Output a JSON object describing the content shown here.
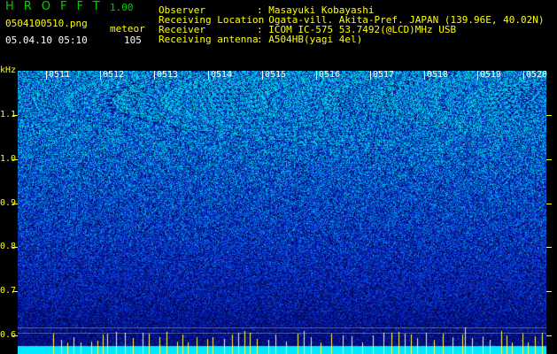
{
  "header": {
    "app_title": "HROFFT",
    "app_version": "1.00",
    "filename": "0504100510.png",
    "meteor_label": "meteor",
    "datetime": "05.04.10 05:10",
    "meteor_count": "105",
    "observer_key": "Observer",
    "observer_value": ": Masayuki Kobayashi",
    "location_key": "Receiving Location",
    "location_value": ": Ogata-vill. Akita-Pref. JAPAN (139.96E, 40.02N)",
    "receiver_key": "Receiver",
    "receiver_value": ": ICOM IC-575 53.7492(@LCD)MHz USB",
    "antenna_key": "Receiving antenna",
    "antenna_value": ": A504HB(yagi 4el)"
  },
  "y_axis": {
    "unit": "kHz",
    "ticks": [
      "1.1",
      "1.0",
      "0.9",
      "0.8",
      "0.7",
      "0.6"
    ]
  },
  "x_axis": {
    "minutes": [
      "0511",
      "0512",
      "0513",
      "0514",
      "0515",
      "0516",
      "0517",
      "0518",
      "0519",
      "0520"
    ]
  },
  "colors": {
    "background": "#000000",
    "title_green": "#00d000",
    "label_yellow": "#ffff00",
    "text_white": "#ffffff",
    "noise_deep": "#000a50",
    "noise_mid": "#1030d0",
    "noise_bright": "#00c8d8",
    "baseline_cyan": "#00e8ff",
    "meteor_yellow": "#ffff40"
  }
}
